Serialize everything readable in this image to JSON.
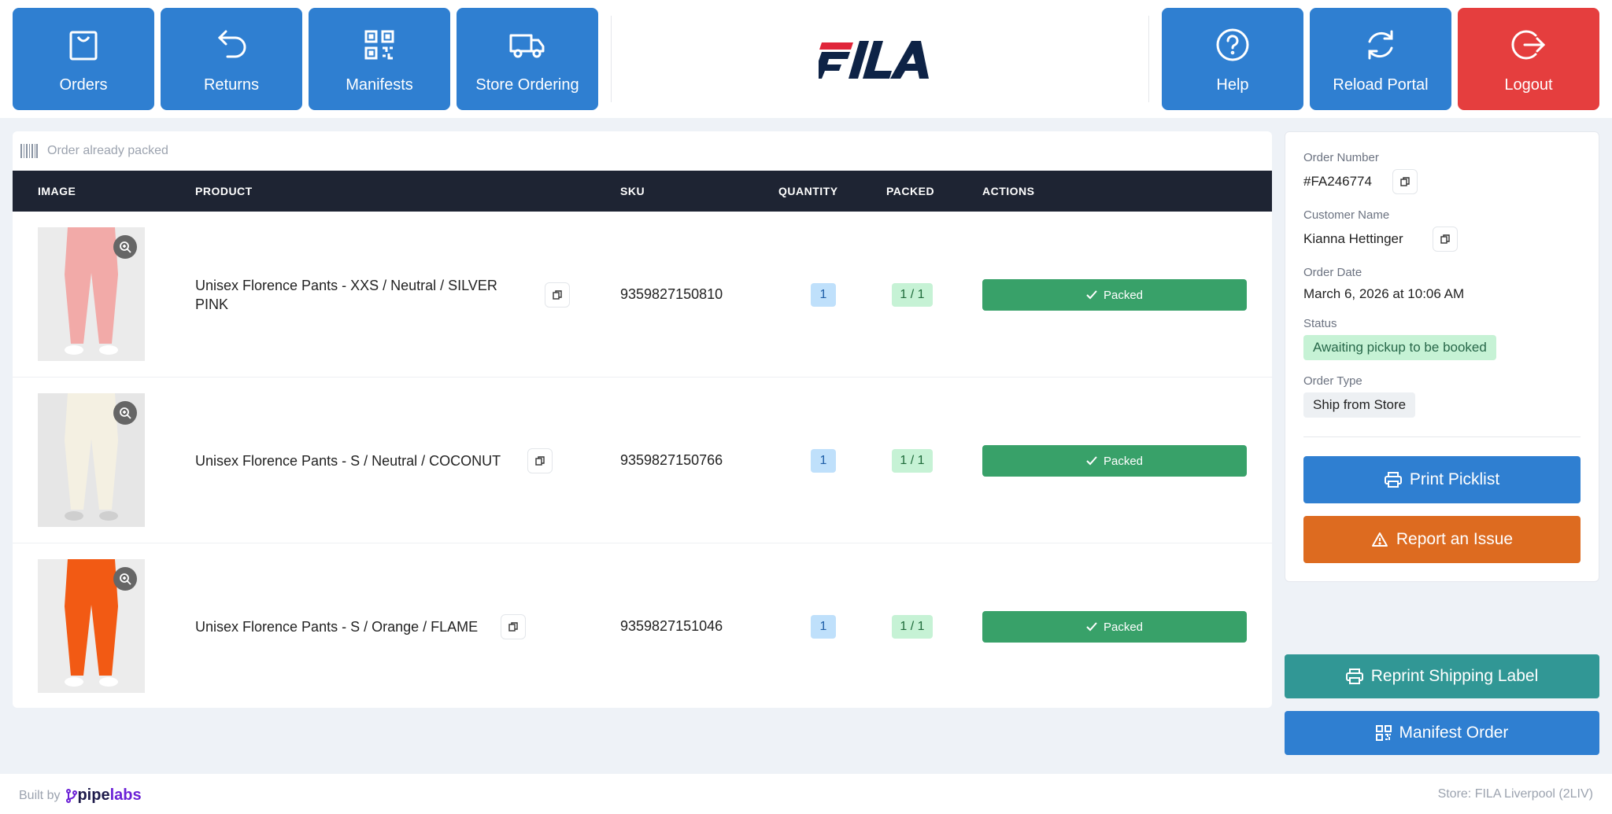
{
  "nav": {
    "orders": "Orders",
    "returns": "Returns",
    "manifests": "Manifests",
    "store_ordering": "Store Ordering",
    "help": "Help",
    "reload": "Reload Portal",
    "logout": "Logout"
  },
  "brand": {
    "logo_text": "FILA"
  },
  "scan": {
    "placeholder": "Order already packed"
  },
  "table": {
    "headers": [
      "IMAGE",
      "PRODUCT",
      "SKU",
      "QUANTITY",
      "PACKED",
      "ACTIONS"
    ],
    "rows": [
      {
        "product": "Unisex Florence Pants - XXS / Neutral / SILVER PINK",
        "sku": "9359827150810",
        "quantity": "1",
        "packed": "1 / 1",
        "action": "Packed",
        "image_color": "#f2aaa8"
      },
      {
        "product": "Unisex Florence Pants - S / Neutral / COCONUT",
        "sku": "9359827150766",
        "quantity": "1",
        "packed": "1 / 1",
        "action": "Packed",
        "image_color": "#f4f0e2"
      },
      {
        "product": "Unisex Florence Pants - S / Orange / FLAME",
        "sku": "9359827151046",
        "quantity": "1",
        "packed": "1 / 1",
        "action": "Packed",
        "image_color": "#f25a14"
      }
    ]
  },
  "order": {
    "number_label": "Order Number",
    "number": "#FA246774",
    "customer_label": "Customer Name",
    "customer": "Kianna Hettinger",
    "date_label": "Order Date",
    "date": "March 6, 2026 at 10:06 AM",
    "status_label": "Status",
    "status": "Awaiting pickup to be booked",
    "type_label": "Order Type",
    "type": "Ship from Store"
  },
  "actions": {
    "print_picklist": "Print Picklist",
    "report_issue": "Report an Issue",
    "reprint_label": "Reprint Shipping Label",
    "manifest_order": "Manifest Order"
  },
  "footer": {
    "built_by": "Built by",
    "brand_a": "pipe",
    "brand_b": "labs",
    "store": "Store: FILA Liverpool (2LIV)"
  },
  "colors": {
    "primary": "#2f7fd1",
    "danger": "#e53e3e",
    "success": "#38a169",
    "warning": "#dd6b20",
    "teal": "#319795",
    "table_header": "#1e2433"
  }
}
